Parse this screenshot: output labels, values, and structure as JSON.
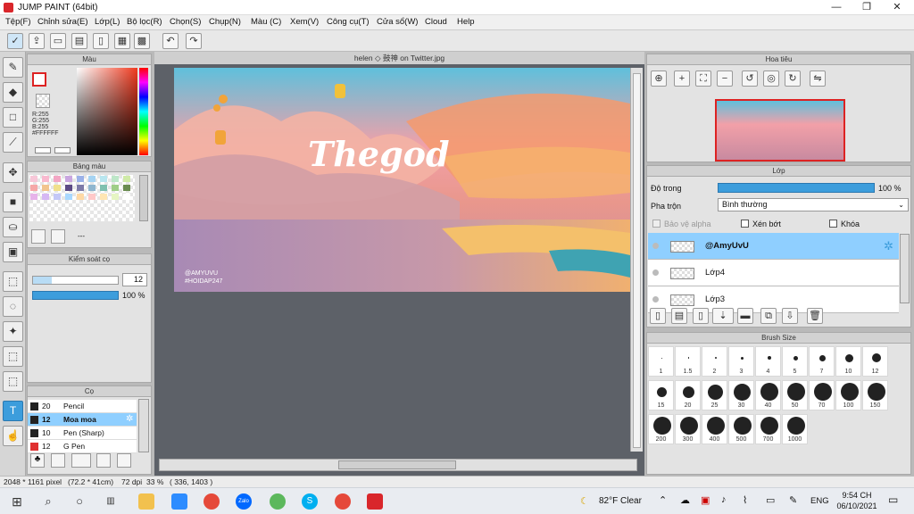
{
  "window": {
    "title": "JUMP PAINT (64bit)",
    "minimize": "—",
    "restore": "❐",
    "close": "✕"
  },
  "menu": [
    "Tệp(F)",
    "Chỉnh sửa(E)",
    "Lớp(L)",
    "Bộ lọc(R)",
    "Chọn(S)",
    "Chụp(N)",
    "Màu (C)",
    "Xem(V)",
    "Công cụ(T)",
    "Cửa sổ(W)",
    "Cloud",
    "Help"
  ],
  "toolbar": {
    "icons": [
      "layout-icon",
      "export-icon",
      "comment-icon",
      "note-icon",
      "document-icon",
      "page-icon",
      "grid-icon"
    ],
    "undo": "↶",
    "redo": "↷"
  },
  "colors": {
    "accent": "#3c9ddc",
    "selected_row": "#8fcfff",
    "taskbar": "#e9ecf1"
  },
  "color_panel": {
    "title": "Màu",
    "r": "R:255",
    "g": "G:255",
    "b": "B:255",
    "hex": "#FFFFFF"
  },
  "palette_panel": {
    "title": "Bảng màu",
    "menu_dots": "---"
  },
  "brush_control": {
    "title": "Kiểm soát cọ",
    "size": "12",
    "opacity": "100 %"
  },
  "pen_panel": {
    "title": "Cọ",
    "items": [
      {
        "size": "20",
        "name": "Pencil",
        "color": "#222222"
      },
      {
        "size": "12",
        "name": "Moa moa",
        "color": "#222222"
      },
      {
        "size": "10",
        "name": "Pen (Sharp)",
        "color": "#222222"
      },
      {
        "size": "12",
        "name": "G Pen",
        "color": "#e03030"
      }
    ]
  },
  "canvas": {
    "tab_title": "helen ◇ 鼓神 on Twitter.jpg",
    "art_title": "Thegod",
    "watermark1": "@AMYUVU",
    "watermark2": "#HOIDAP247"
  },
  "navigator": {
    "title": "Hoa tiêu"
  },
  "layers_panel": {
    "title": "Lớp",
    "opacity_label": "Độ trong",
    "opacity_value": "100 %",
    "blend_label": "Pha trộn",
    "blend_value": "Bình thường",
    "protect_alpha": "Bảo vệ alpha",
    "clipping": "Xén bớt",
    "lock": "Khóa",
    "layers": [
      "@AmyUvU",
      "Lớp4",
      "Lớp3"
    ]
  },
  "brush_size": {
    "title": "Brush Size",
    "sizes": [
      "1",
      "1.5",
      "2",
      "3",
      "4",
      "5",
      "7",
      "10",
      "12",
      "15",
      "20",
      "25",
      "30",
      "40",
      "50",
      "70",
      "100",
      "150",
      "200",
      "300",
      "400",
      "500",
      "700",
      "1000"
    ]
  },
  "status": {
    "dimensions": "2048 * 1161 pixel",
    "physical": "(72.2 * 41cm)",
    "dpi": "72 dpi",
    "zoom": "33 %",
    "coords": "( 336, 1403 )"
  },
  "taskbar": {
    "weather": "82°F Clear",
    "lang": "ENG",
    "time": "9:54 CH",
    "date": "06/10/2021"
  }
}
